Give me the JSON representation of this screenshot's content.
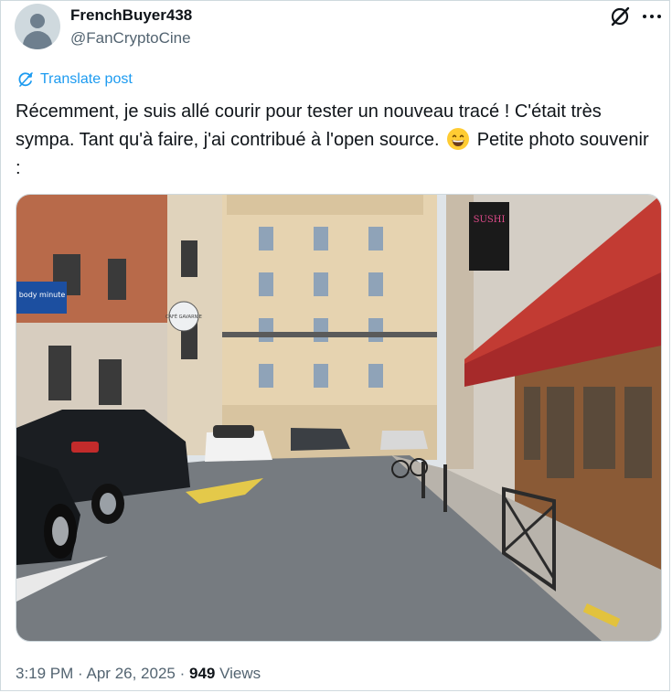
{
  "author": {
    "display_name": "FrenchBuyer438",
    "handle": "@FanCryptoCine"
  },
  "header_icons": [
    "grok-icon",
    "more-icon"
  ],
  "translate": {
    "label": "Translate post",
    "icon": "translate-icon"
  },
  "post": {
    "text_part1": "Récemment, je suis allé courir pour tester un nouveau tracé ! C'était très sympa. Tant qu'à faire, j'ai contribué à l'open source.",
    "emoji": "grinning-face-emoji",
    "text_part2": "Petite photo souvenir :"
  },
  "photo": {
    "shop_sign_left": "body minute",
    "round_sign": "CAFÉ GAVARNIE",
    "vertical_sign": "SUSHI"
  },
  "footer": {
    "time": "3:19 PM",
    "separator": "·",
    "date": "Apr 26, 2025",
    "views_count": "949",
    "views_label": "Views"
  },
  "colors": {
    "accent": "#1d9bf0",
    "text": "#0f1419",
    "secondary": "#536471",
    "border": "#cfd9de"
  }
}
